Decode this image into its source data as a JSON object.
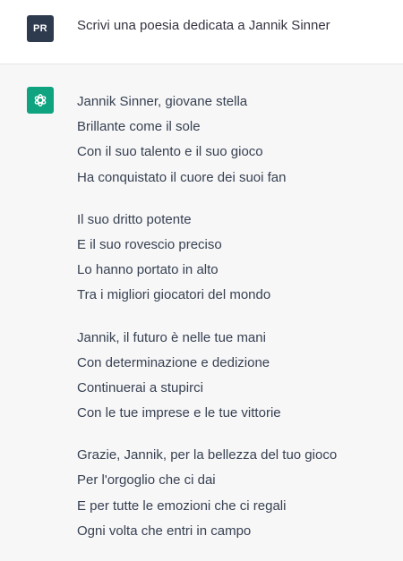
{
  "user": {
    "avatar_initials": "PR",
    "message": "Scrivi una poesia dedicata a Jannik Sinner"
  },
  "assistant": {
    "avatar_icon": "openai-logo-icon",
    "avatar_color": "#10a37f",
    "stanzas": [
      {
        "lines": [
          "Jannik Sinner, giovane stella",
          "Brillante come il sole",
          "Con il suo talento e il suo gioco",
          "Ha conquistato il cuore dei suoi fan"
        ]
      },
      {
        "lines": [
          "Il suo dritto potente",
          "E il suo rovescio preciso",
          "Lo hanno portato in alto",
          "Tra i migliori giocatori del mondo"
        ]
      },
      {
        "lines": [
          "Jannik, il futuro è nelle tue mani",
          "Con determinazione e dedizione",
          "Continuerai a stupirci",
          "Con le tue imprese e le tue vittorie"
        ]
      },
      {
        "lines": [
          "Grazie, Jannik, per la bellezza del tuo gioco",
          "Per l'orgoglio che ci dai",
          "E per tutte le emozioni che ci regali",
          "Ogni volta che entri in campo"
        ]
      }
    ]
  }
}
